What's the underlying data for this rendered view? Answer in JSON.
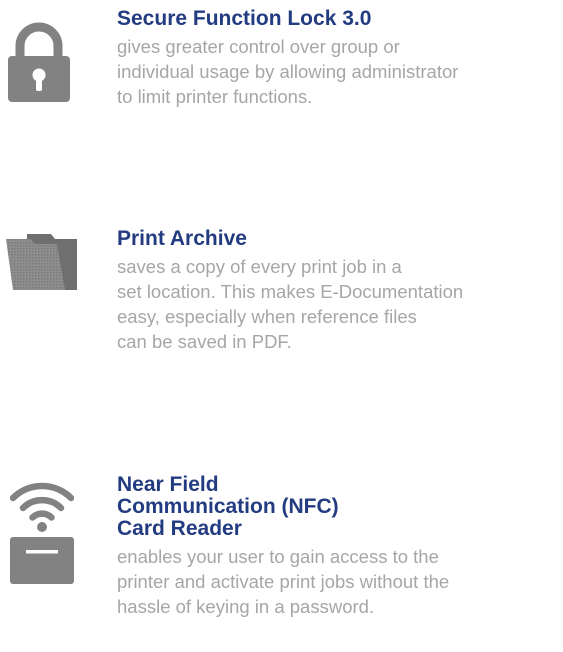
{
  "colors": {
    "title": "#233b80",
    "description": "#a6a6a6",
    "icon": "#828282"
  },
  "features": [
    {
      "icon": "lock-icon",
      "title_lines": [
        "Secure Function Lock 3.0"
      ],
      "description_lines": [
        "gives greater control over group or",
        "individual usage by allowing administrator",
        "to limit printer functions."
      ]
    },
    {
      "icon": "folder-icon",
      "title_lines": [
        "Print Archive"
      ],
      "description_lines": [
        "saves a copy of every print job in a",
        "set location. This makes E-Documentation",
        "easy, especially when reference files",
        "can be saved in PDF."
      ]
    },
    {
      "icon": "nfc-card-reader-icon",
      "title_lines": [
        "Near Field",
        "Communication (NFC)",
        "Card Reader"
      ],
      "description_lines": [
        "enables your user to gain access to the",
        "printer and activate print jobs without the",
        "hassle of keying in a password."
      ]
    }
  ]
}
